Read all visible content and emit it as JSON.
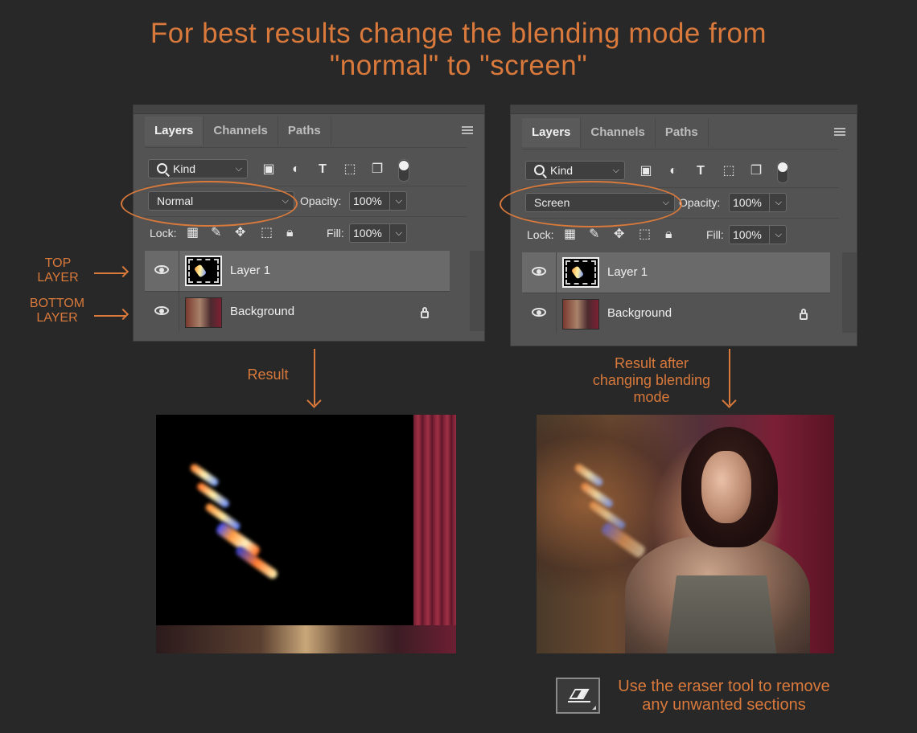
{
  "title": {
    "line1": "For best results change the blending mode from",
    "line2": "\"normal\" to \"screen\""
  },
  "side_labels": {
    "top_layer": [
      "TOP",
      "LAYER"
    ],
    "bottom_layer": [
      "BOTTOM",
      "LAYER"
    ]
  },
  "panels": [
    {
      "tabs": [
        "Layers",
        "Channels",
        "Paths"
      ],
      "filter_kind": "Kind",
      "blend_mode": "Normal",
      "opacity_label": "Opacity:",
      "opacity_value": "100%",
      "lock_label": "Lock:",
      "fill_label": "Fill:",
      "fill_value": "100%",
      "layers": [
        "Layer 1",
        "Background"
      ]
    },
    {
      "tabs": [
        "Layers",
        "Channels",
        "Paths"
      ],
      "filter_kind": "Kind",
      "blend_mode": "Screen",
      "opacity_label": "Opacity:",
      "opacity_value": "100%",
      "lock_label": "Lock:",
      "fill_label": "Fill:",
      "fill_value": "100%",
      "layers": [
        "Layer 1",
        "Background"
      ]
    }
  ],
  "captions": {
    "left": "Result",
    "right": [
      "Result after",
      "changing blending",
      "mode"
    ]
  },
  "eraser_note": [
    "Use the eraser tool to remove",
    "any unwanted sections"
  ],
  "colors": {
    "accent": "#d9793b",
    "background": "#282828",
    "panel": "#535353"
  },
  "icons": [
    "search-icon",
    "image-filter-icon",
    "adjustment-filter-icon",
    "type-filter-icon",
    "shape-filter-icon",
    "smart-object-filter-icon",
    "eye-icon",
    "lock-icon",
    "eraser-icon",
    "panel-menu-icon"
  ]
}
